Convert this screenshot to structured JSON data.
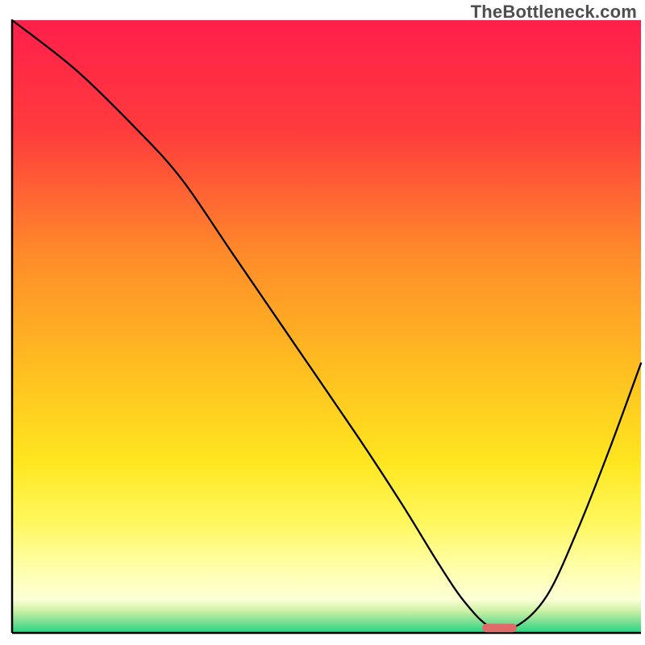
{
  "watermark": "TheBottleneck.com",
  "chart_data": {
    "type": "line",
    "title": "",
    "xlabel": "",
    "ylabel": "",
    "xlim": [
      0,
      100
    ],
    "ylim": [
      0,
      100
    ],
    "grid": false,
    "background": {
      "gradient_stops": [
        {
          "offset": 0.0,
          "color": "#ff1f4b"
        },
        {
          "offset": 0.18,
          "color": "#ff3b3d"
        },
        {
          "offset": 0.38,
          "color": "#ff8a2a"
        },
        {
          "offset": 0.58,
          "color": "#ffc120"
        },
        {
          "offset": 0.72,
          "color": "#ffe61f"
        },
        {
          "offset": 0.82,
          "color": "#fff85e"
        },
        {
          "offset": 0.9,
          "color": "#ffffb0"
        },
        {
          "offset": 0.945,
          "color": "#fdffd6"
        },
        {
          "offset": 0.965,
          "color": "#c9f0a4"
        },
        {
          "offset": 0.985,
          "color": "#6edc8f"
        },
        {
          "offset": 1.0,
          "color": "#1ed87f"
        }
      ]
    },
    "series": [
      {
        "name": "bottleneck-curve",
        "color": "#000000",
        "x": [
          0,
          10,
          20,
          27,
          35,
          45,
          55,
          62,
          68,
          72,
          76,
          80,
          85,
          90,
          95,
          100
        ],
        "y": [
          100,
          92,
          82,
          74,
          62,
          47,
          32,
          21,
          11,
          5,
          1,
          1,
          6,
          17,
          30,
          44
        ]
      }
    ],
    "marker": {
      "name": "optimal-range",
      "color": "#e06a6a",
      "x_center": 77.5,
      "y": 0.8,
      "width": 5.5,
      "height": 1.4
    }
  }
}
